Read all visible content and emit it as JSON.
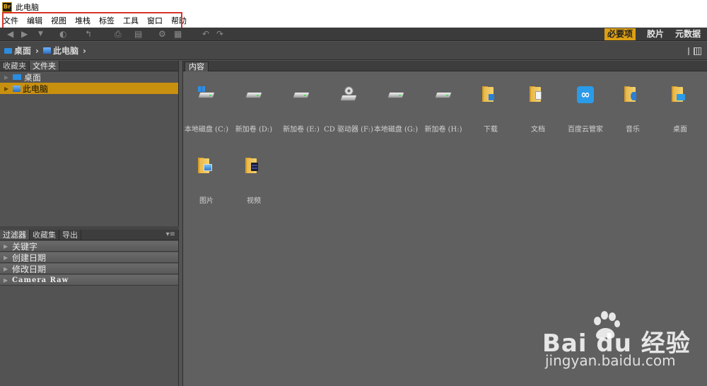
{
  "window": {
    "app_badge": "Br",
    "title": "此电脑"
  },
  "menu": {
    "items": [
      "文件",
      "编辑",
      "视图",
      "堆栈",
      "标签",
      "工具",
      "窗口",
      "帮助"
    ]
  },
  "toolbar": {
    "workspaces": [
      "必要项",
      "胶片",
      "元数据"
    ],
    "active_workspace": "必要项"
  },
  "path": {
    "crumbs": [
      "桌面",
      "此电脑"
    ]
  },
  "left_top_panel": {
    "tabs": [
      "收藏夹",
      "文件夹"
    ],
    "active_tab": "文件夹",
    "tree": [
      {
        "label": "桌面",
        "selected": false
      },
      {
        "label": "此电脑",
        "selected": true
      }
    ]
  },
  "left_bottom_panel": {
    "tabs": [
      "过滤器",
      "收藏集",
      "导出"
    ],
    "active_tab": "过滤器",
    "filters": [
      "关键字",
      "创建日期",
      "修改日期",
      "Camera Raw"
    ]
  },
  "content": {
    "tab": "内容",
    "items": [
      {
        "label": "本地磁盘 (C:)",
        "icon": "system-drive-icon"
      },
      {
        "label": "新加卷 (D:)",
        "icon": "drive-icon"
      },
      {
        "label": "新加卷 (E:)",
        "icon": "drive-icon"
      },
      {
        "label": "CD 驱动器 (F:)",
        "icon": "cd-drive-icon"
      },
      {
        "label": "本地磁盘 (G:)",
        "icon": "drive-icon"
      },
      {
        "label": "新加卷 (H:)",
        "icon": "drive-icon"
      },
      {
        "label": "下载",
        "icon": "downloads-folder-icon"
      },
      {
        "label": "文档",
        "icon": "documents-folder-icon"
      },
      {
        "label": "百度云管家",
        "icon": "baidu-cloud-icon"
      },
      {
        "label": "音乐",
        "icon": "music-folder-icon"
      },
      {
        "label": "桌面",
        "icon": "desktop-folder-icon"
      },
      {
        "label": "图片",
        "icon": "pictures-folder-icon"
      },
      {
        "label": "视频",
        "icon": "videos-folder-icon"
      }
    ]
  },
  "watermark": {
    "brand": "Bai du 经验",
    "url": "jingyan.baidu.com"
  },
  "colors": {
    "accent": "#dca015",
    "selection": "#c8900f",
    "highlight_box": "#d9342b"
  }
}
